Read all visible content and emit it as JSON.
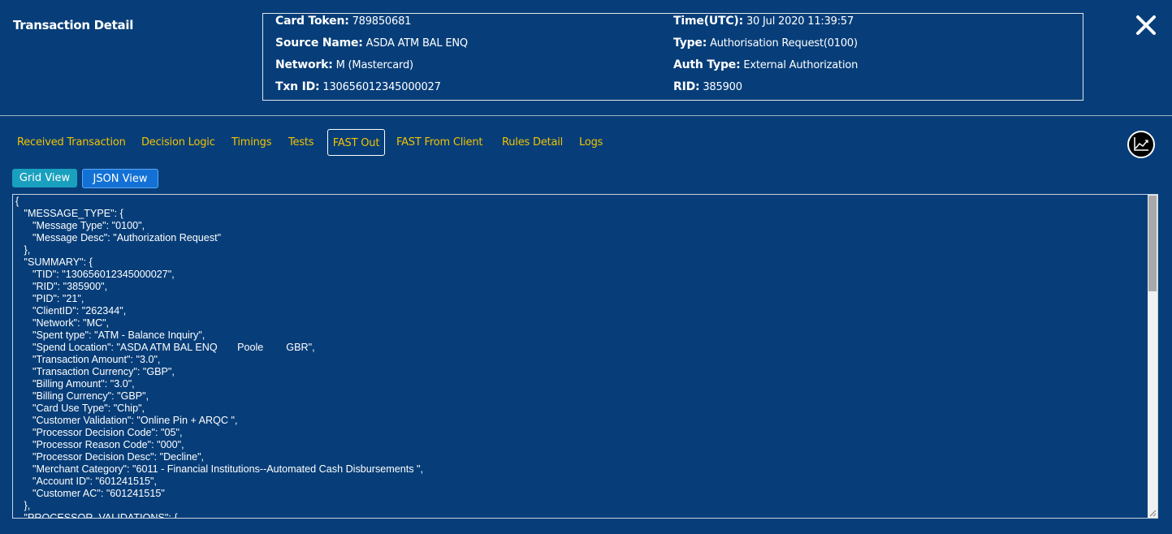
{
  "header": {
    "title": "Transaction Detail"
  },
  "info": {
    "card_token": {
      "label": "Card Token:",
      "value": "789850681"
    },
    "source_name": {
      "label": "Source Name:",
      "value": "ASDA ATM BAL ENQ"
    },
    "network": {
      "label": "Network:",
      "value": "M (Mastercard)"
    },
    "txn_id": {
      "label": "Txn ID:",
      "value": "130656012345000027"
    },
    "time": {
      "label": "Time(UTC):",
      "value": "30 Jul 2020 11:39:57"
    },
    "type": {
      "label": "Type:",
      "value": "Authorisation Request(0100)"
    },
    "auth_type": {
      "label": "Auth Type:",
      "value": "External Authorization"
    },
    "rid": {
      "label": "RID:",
      "value": "385900"
    }
  },
  "tabs": [
    {
      "label": "Received Transaction"
    },
    {
      "label": "Decision Logic"
    },
    {
      "label": "Timings"
    },
    {
      "label": "Tests"
    },
    {
      "label": "FAST Out",
      "active": true
    },
    {
      "label": "FAST From Client"
    },
    {
      "label": "Rules Detail"
    },
    {
      "label": "Logs"
    }
  ],
  "views": {
    "grid_label": "Grid View",
    "json_label": "JSON View",
    "selected": "JSON View"
  },
  "json_content": "{\n   \"MESSAGE_TYPE\": {\n      \"Message Type\": \"0100\",\n      \"Message Desc\": \"Authorization Request\"\n   },\n   \"SUMMARY\": {\n      \"TID\": \"130656012345000027\",\n      \"RID\": \"385900\",\n      \"PID\": \"21\",\n      \"ClientID\": \"262344\",\n      \"Network\": \"MC\",\n      \"Spent type\": \"ATM - Balance Inquiry\",\n      \"Spend Location\": \"ASDA ATM BAL ENQ       Poole        GBR\",\n      \"Transaction Amount\": \"3.0\",\n      \"Transaction Currency\": \"GBP\",\n      \"Billing Amount\": \"3.0\",\n      \"Billing Currency\": \"GBP\",\n      \"Card Use Type\": \"Chip\",\n      \"Customer Validation\": \"Online Pin + ARQC \",\n      \"Processor Decision Code\": \"05\",\n      \"Processor Reason Code\": \"000\",\n      \"Processor Decision Desc\": \"Decline\",\n      \"Merchant Category\": \"6011 - Financial Institutions--Automated Cash Disbursements \",\n      \"Account ID\": \"601241515\",\n      \"Customer AC\": \"601241515\"\n   },\n   \"PROCESSOR_VALIDATIONS\": {",
  "icons": {
    "close": "close-icon",
    "chart": "line-chart-icon"
  },
  "colors": {
    "background": "#073e79",
    "tab_text": "#f2c200",
    "grid_button": "#1aa0bf",
    "json_button": "#1371d6"
  }
}
